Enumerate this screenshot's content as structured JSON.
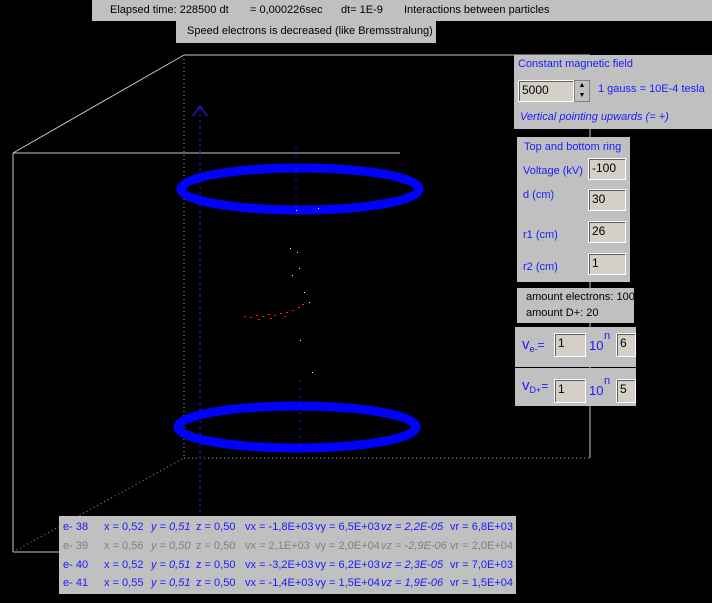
{
  "status": {
    "elapsed": "Elapsed time: 228500 dt",
    "elapsed_sec": "= 0,000226sec",
    "dt": "dt= 1E-9",
    "title": "Interactions between particles",
    "note": "Speed electrons is decreased (like Bremsstralung)"
  },
  "magnetic": {
    "header": "Constant magnetic field",
    "value": "5000",
    "conversion": "1 gauss = 10E-4 tesla",
    "direction": "Vertical pointing upwards (= +)"
  },
  "rings": {
    "header": "Top and bottom ring",
    "voltage_label": "Voltage (kV)",
    "voltage": "-100",
    "d_label": "d (cm)",
    "d": "30",
    "r1_label": "r1 (cm)",
    "r1": "26",
    "r2_label": "r2 (cm)",
    "r2": "1"
  },
  "amounts": {
    "electrons": "amount electrons: 100",
    "deuterons": "amount D+: 20"
  },
  "velocity_e": {
    "label": "v",
    "sub": "e-",
    "eq": "=",
    "mantissa": "1",
    "ten": "10",
    "n": "n",
    "exp": "6"
  },
  "velocity_d": {
    "label": "v",
    "sub": "D+",
    "eq": "=",
    "mantissa": "1",
    "ten": "10",
    "n": "n",
    "exp": "5"
  },
  "electrons": [
    {
      "id": "e- 38",
      "x": "x = 0,52",
      "y": "y = 0,51",
      "z": "z = 0,50",
      "vx": "vx = -1,8E+03",
      "vy": "vy = 6,5E+03",
      "vz": "vz = 2,2E-05",
      "vr": "vr = 6,8E+03",
      "color": "#1a1aff"
    },
    {
      "id": "e- 39",
      "x": "x = 0,56",
      "y": "y = 0,50",
      "z": "z = 0,50",
      "vx": "vx = 2,1E+03",
      "vy": "vy = 2,0E+04",
      "vz": "vz = -2,9E-06",
      "vr": "vr = 2,0E+04",
      "color": "#808080"
    },
    {
      "id": "e- 40",
      "x": "x = 0,52",
      "y": "y = 0,51",
      "z": "z = 0,50",
      "vx": "vx = -3,2E+03",
      "vy": "vy = 6,2E+03",
      "vz": "vz = 2,3E-05",
      "vr": "vr = 7,0E+03",
      "color": "#1a1aff"
    },
    {
      "id": "e- 41",
      "x": "x = 0,55",
      "y": "y = 0,51",
      "z": "z = 0,50",
      "vx": "vx = -1,4E+03",
      "vy": "vy = 1,5E+04",
      "vz": "vz = 1,9E-06",
      "vr": "vr = 1,5E+04",
      "color": "#1a1aff"
    }
  ],
  "colors": {
    "ring": "#0000ff",
    "panel": "#c0c0c0",
    "label_blue": "#1a1aff",
    "particles_d": "#ff0000"
  }
}
